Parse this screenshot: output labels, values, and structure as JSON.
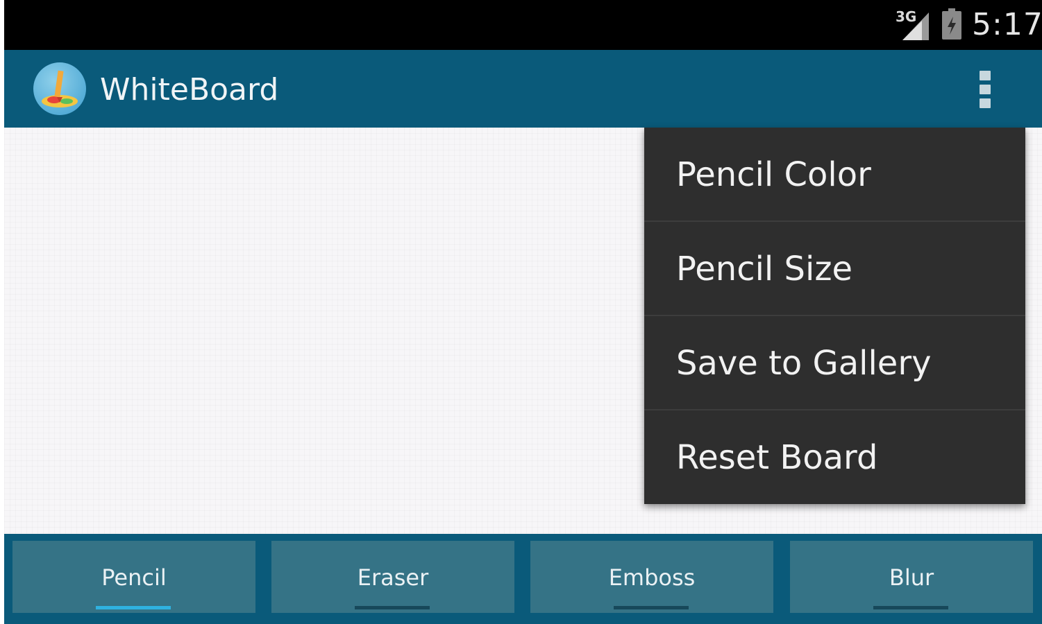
{
  "status_bar": {
    "network": "3G",
    "time": "5:17",
    "signal_icon": "signal-icon",
    "battery_icon": "battery-icon"
  },
  "action_bar": {
    "title": "WhiteBoard",
    "app_icon": "whiteboard-app-icon",
    "overflow_icon": "more-vert-icon"
  },
  "menu": {
    "items": [
      {
        "label": "Pencil Color"
      },
      {
        "label": "Pencil Size"
      },
      {
        "label": "Save to Gallery"
      },
      {
        "label": "Reset Board"
      }
    ]
  },
  "toolbar": {
    "buttons": [
      {
        "label": "Pencil",
        "selected": true
      },
      {
        "label": "Eraser",
        "selected": false
      },
      {
        "label": "Emboss",
        "selected": false
      },
      {
        "label": "Blur",
        "selected": false
      }
    ]
  },
  "colors": {
    "action_bar": "#0a5a7a",
    "toolbar_button": "#357386",
    "menu_background": "#2e2e2e",
    "active_indicator": "#2fb2e0"
  }
}
